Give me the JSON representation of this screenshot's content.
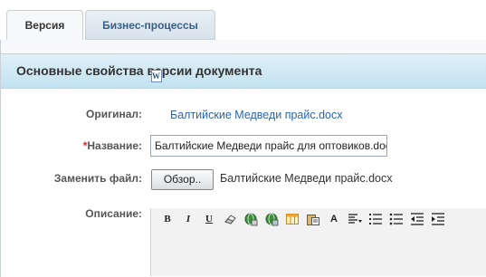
{
  "tabs": [
    {
      "label": "Версия",
      "active": true
    },
    {
      "label": "Бизнес-процессы",
      "active": false
    }
  ],
  "section": {
    "title": "Основные свойства версии документа"
  },
  "form": {
    "original": {
      "label": "Оригинал:",
      "value": "Балтийские Медведи прайс.docx",
      "icon": "word-document-icon"
    },
    "name": {
      "required_mark": "*",
      "label": "Название:",
      "value": "Балтийские Медведи прайс для оптовиков.docx"
    },
    "replace_file": {
      "label": "Заменить файл:",
      "button_label": "Обзор..",
      "file_name": "Балтийские Медведи прайс.docx"
    },
    "description": {
      "label": "Описание:"
    }
  },
  "editor_toolbar": {
    "buttons": [
      "bold-icon",
      "italic-icon",
      "underline-icon",
      "eraser-icon",
      "insert-link-icon",
      "remove-link-icon",
      "insert-table-icon",
      "paste-icon",
      "font-size-icon",
      "align-icon",
      "numbered-list-icon",
      "bulleted-list-icon",
      "outdent-icon",
      "indent-icon"
    ],
    "bold_glyph": "B",
    "italic_glyph": "I",
    "underline_glyph": "U",
    "font_glyph": "A"
  },
  "colors": {
    "accent_link": "#2a64b0",
    "header_bg": "#c2e2f0",
    "required": "#d9262e"
  }
}
